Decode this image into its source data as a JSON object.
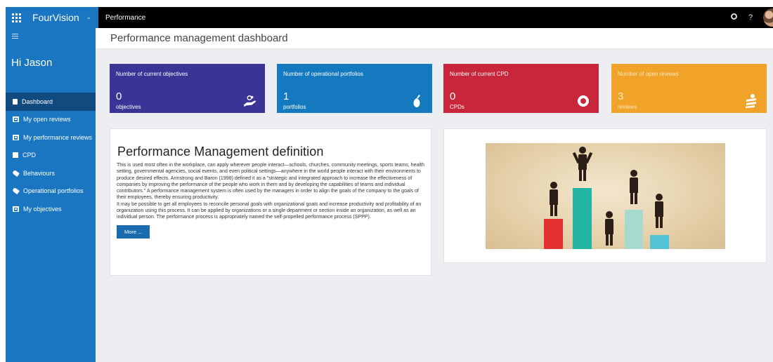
{
  "topbar": {
    "app_name": "FourVision",
    "breadcrumb": "Performance",
    "help_label": "?"
  },
  "sidebar": {
    "greeting": "Hi Jason",
    "items": [
      {
        "label": "Dashboard",
        "icon": "dashboard-icon",
        "active": true
      },
      {
        "label": "My open reviews",
        "icon": "review-icon"
      },
      {
        "label": "My performance reviews",
        "icon": "review-icon"
      },
      {
        "label": "CPD",
        "icon": "square-icon"
      },
      {
        "label": "Behaviours",
        "icon": "tag-icon"
      },
      {
        "label": "Operational portfolios",
        "icon": "tag-icon"
      },
      {
        "label": "My objectives",
        "icon": "review-icon"
      }
    ]
  },
  "main": {
    "page_title": "Performance management dashboard",
    "tiles": [
      {
        "title": "Number of current objectives",
        "value": "0",
        "unit": "objectives",
        "icon": "hand-objectives-icon",
        "color": "#3a3496"
      },
      {
        "title": "Number of operational portfolios",
        "value": "1",
        "unit": "portfolios",
        "icon": "portfolio-icon",
        "color": "#1579bf"
      },
      {
        "title": "Number of current CPD",
        "value": "0",
        "unit": "CPDs",
        "icon": "target-icon",
        "color": "#c7263b"
      },
      {
        "title": "Number of open reviews",
        "value": "3",
        "unit": "reviews",
        "icon": "hand-reviews-icon",
        "color": "#f1a228"
      }
    ],
    "definition": {
      "heading": "Performance Management definition",
      "paragraph1": "This is used most often in the workplace, can apply wherever people interact—schools, churches, community meetings, sports teams, health setting, governmental agencies, social events, and even political settings—anywhere in the world people interact with their environments to produce desired effects. Armstrong and Baron (1998) defined it as a \"strategic and integrated approach to increase the effectiveness of companies by improving the performance of the people who work in them and by developing the capabilities of teams and individual contributors.\" A performance management system is often used by the managers in order to align the goals of the company to the goals of their employees, thereby ensuring productivity.",
      "paragraph2": "It may be possible to get all employees to reconcile personal goals with organizational goals and increase productivity and profitability of an organization using this process. It can be applied by organizations or a single department or section inside an organization, as well as an individual person. The performance process is appropriately named the self-propelled performance process (SPPP).",
      "more_label": "More ..."
    }
  }
}
